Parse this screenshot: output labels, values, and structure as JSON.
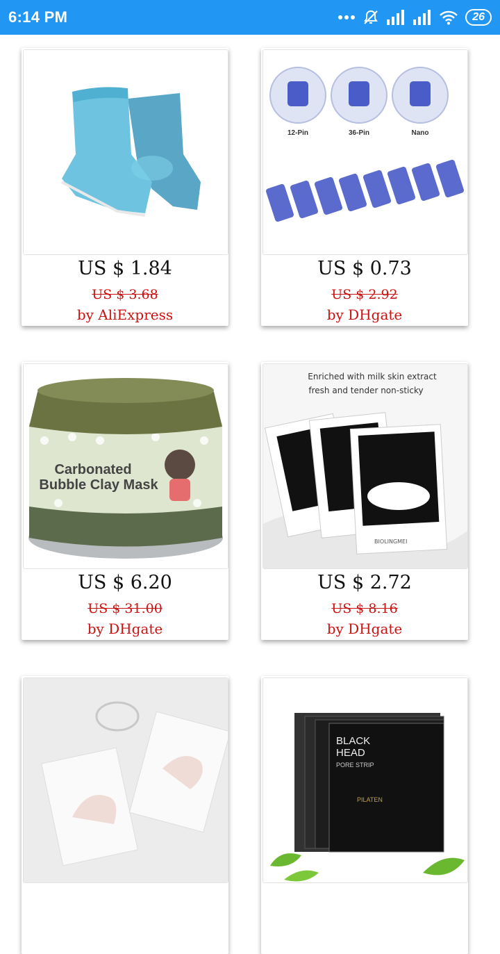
{
  "status_bar": {
    "time": "6:14 PM",
    "battery": "26"
  },
  "products": [
    {
      "price": "US $ 1.84",
      "old_price": "US $ 3.68",
      "seller": "by AliExpress",
      "image": "blue-gel-heel-socks"
    },
    {
      "price": "US $ 0.73",
      "old_price": "US $ 2.92",
      "seller": "by DHgate",
      "image": "needle-cartridges",
      "image_text": {
        "label1": "12-Pin",
        "label2": "36-Pin",
        "label3": "Nano"
      }
    },
    {
      "price": "US $ 6.20",
      "old_price": "US $ 31.00",
      "seller": "by DHgate",
      "image": "bubble-clay-mask-jar",
      "image_text": {
        "line1": "Carbonated",
        "line2": "Bubble Clay Mask"
      }
    },
    {
      "price": "US $ 2.72",
      "old_price": "US $ 8.16",
      "seller": "by DHgate",
      "image": "milk-face-mask-packs",
      "image_text": {
        "line1": "Enriched with milk skin extract",
        "line2": "fresh and tender non-sticky",
        "brand": "BIOLINGMEI"
      }
    },
    {
      "price": "",
      "old_price": "",
      "seller": "",
      "image": "hand-mask-packs"
    },
    {
      "price": "",
      "old_price": "",
      "seller": "",
      "image": "blackhead-pore-strips",
      "image_text": {
        "line1": "BLACK",
        "line2": "HEAD",
        "line3": "PORE STRIP",
        "brand": "PILATEN"
      }
    }
  ]
}
